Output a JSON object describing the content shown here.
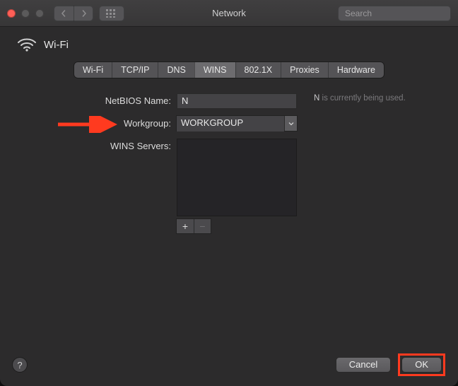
{
  "window": {
    "title": "Network"
  },
  "toolbar": {
    "search_placeholder": "Search"
  },
  "header": {
    "interface_name": "Wi-Fi"
  },
  "tabs": [
    {
      "id": "wifi",
      "label": "Wi-Fi",
      "active": false
    },
    {
      "id": "tcpip",
      "label": "TCP/IP",
      "active": false
    },
    {
      "id": "dns",
      "label": "DNS",
      "active": false
    },
    {
      "id": "wins",
      "label": "WINS",
      "active": true
    },
    {
      "id": "8021x",
      "label": "802.1X",
      "active": false
    },
    {
      "id": "proxies",
      "label": "Proxies",
      "active": false
    },
    {
      "id": "hardware",
      "label": "Hardware",
      "active": false
    }
  ],
  "form": {
    "netbios_label": "NetBIOS Name:",
    "netbios_value": "N",
    "workgroup_label": "Workgroup:",
    "workgroup_value": "WORKGROUP",
    "wins_servers_label": "WINS Servers:",
    "add_label": "+",
    "remove_label": "−",
    "hint_line1": "N",
    "hint_line2": " is currently being used."
  },
  "footer": {
    "help_glyph": "?",
    "cancel_label": "Cancel",
    "ok_label": "OK"
  },
  "annotations": {
    "arrow_target": "workgroup-field",
    "highlight_target": "ok-button",
    "colors": {
      "arrow": "#ff3a1f",
      "highlight": "#ff3a1f"
    }
  }
}
